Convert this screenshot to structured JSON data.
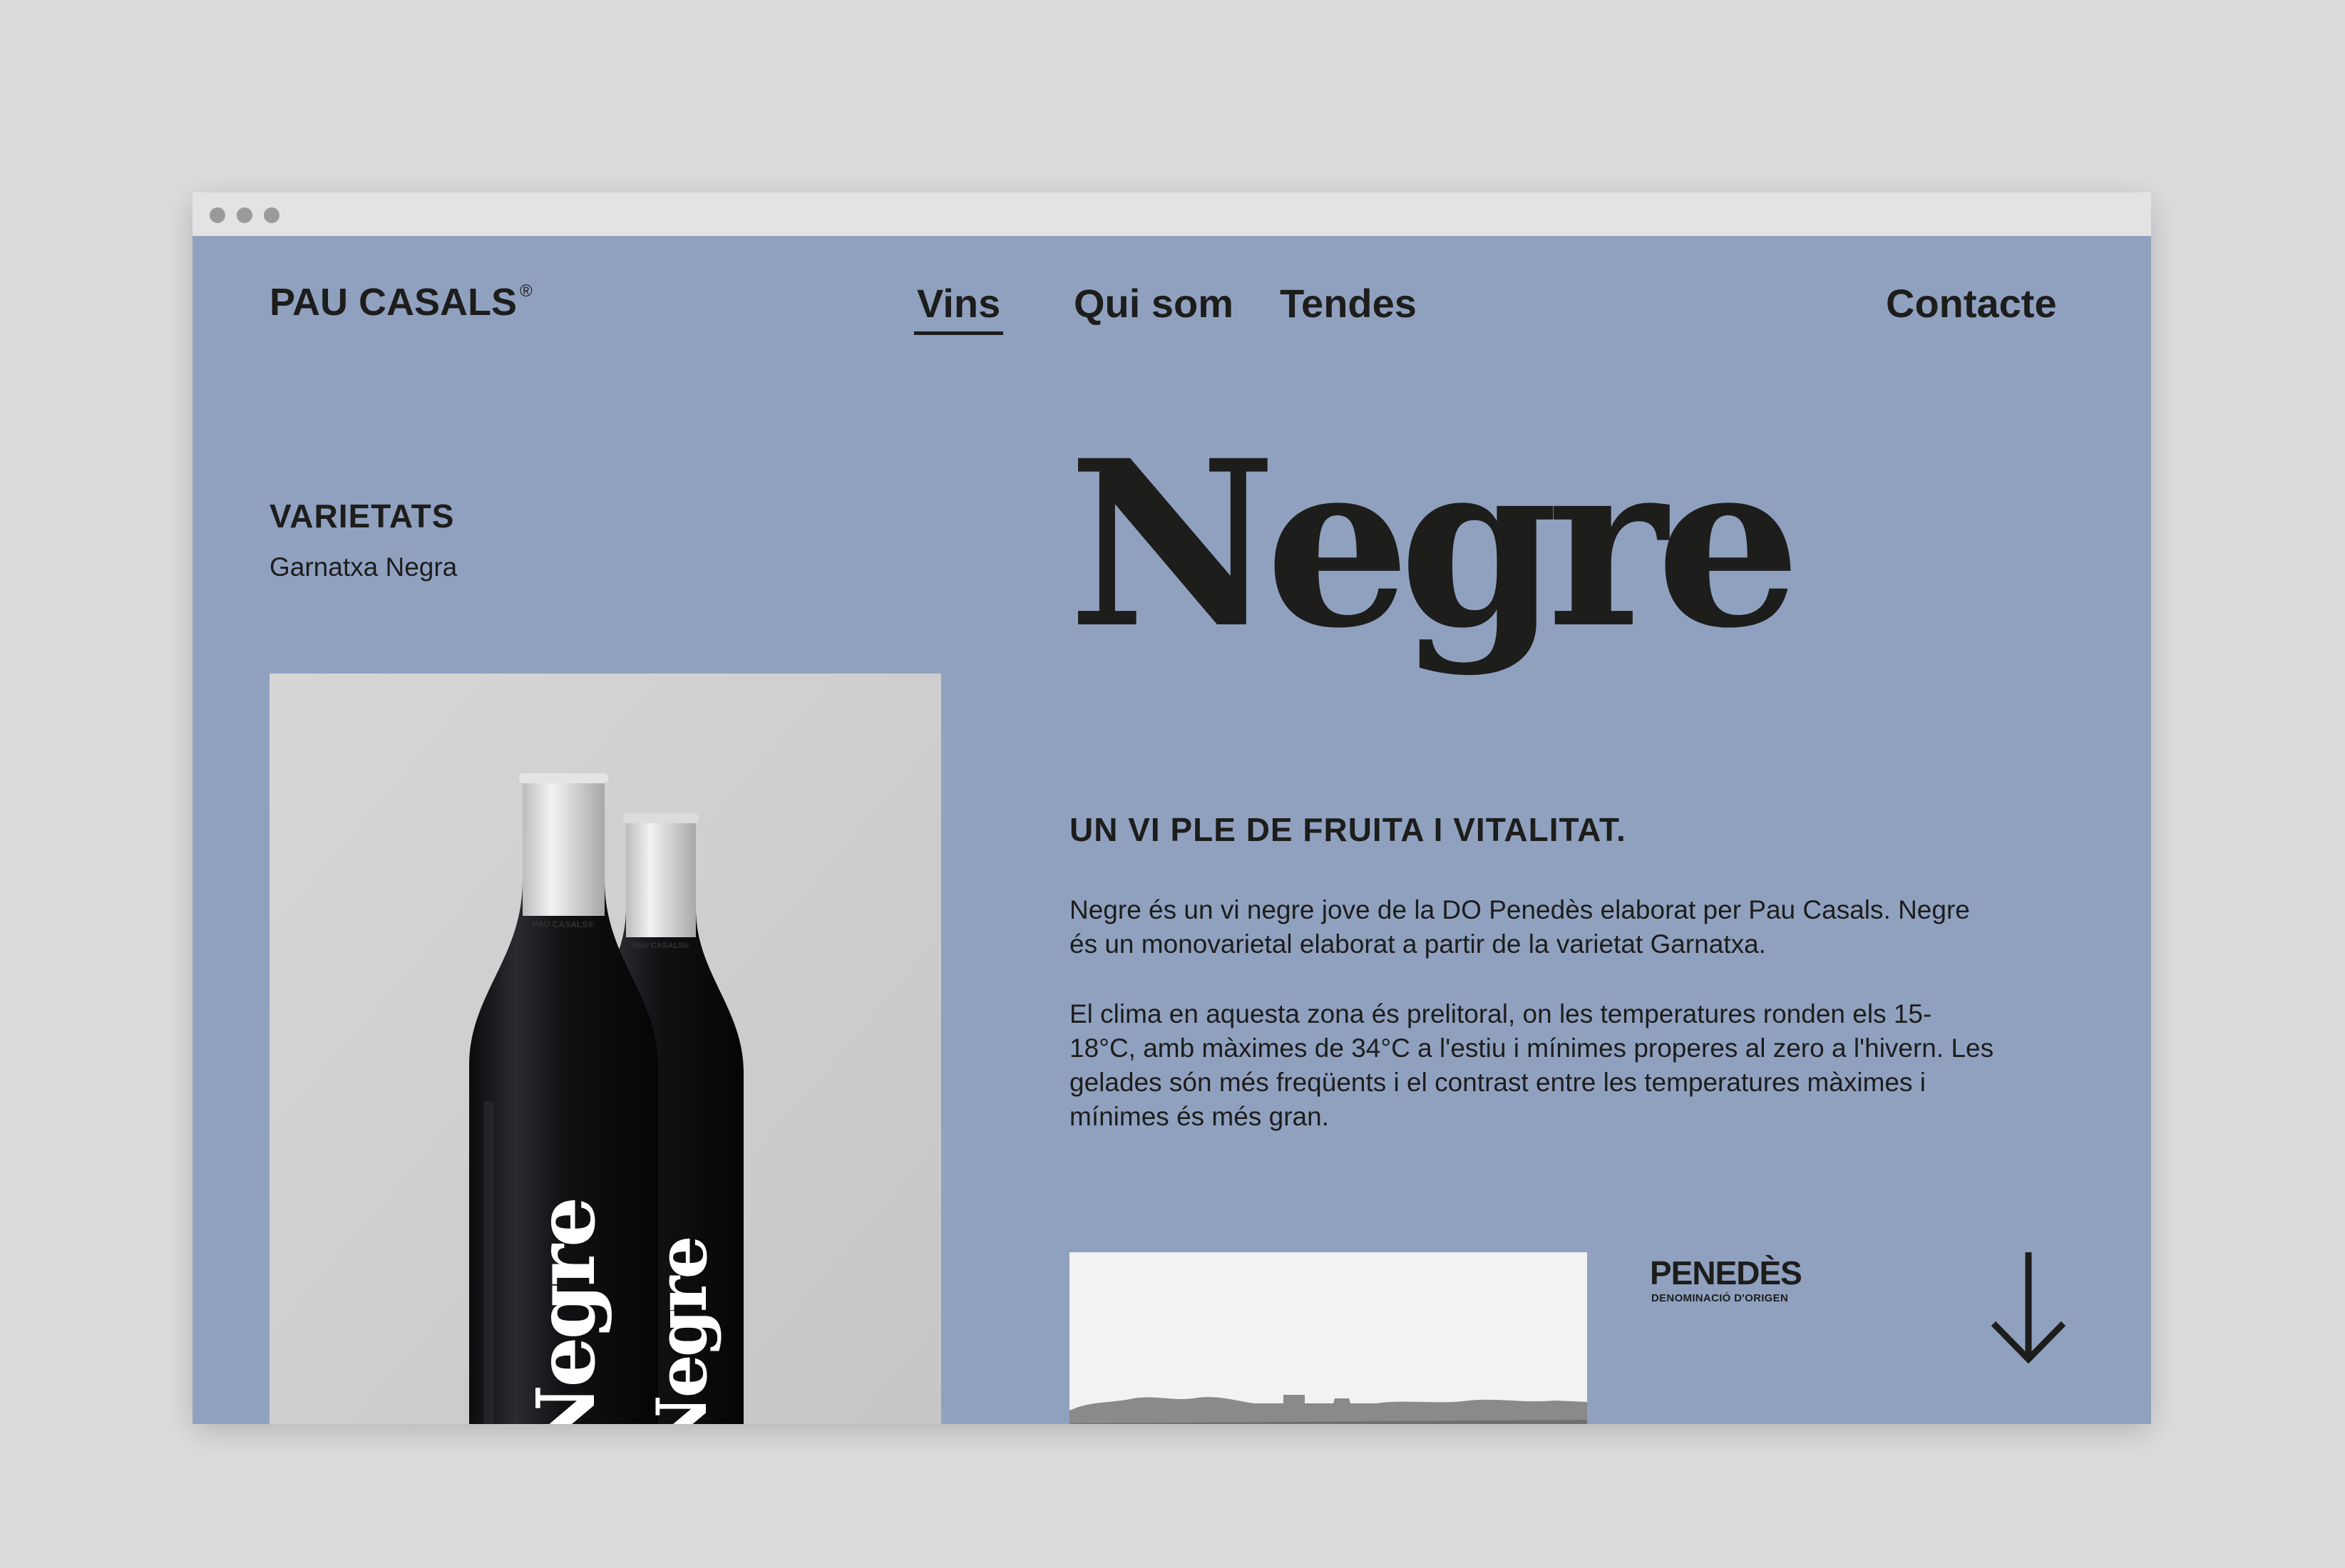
{
  "brand": {
    "name": "PAU CASALS",
    "mark": "®"
  },
  "nav": {
    "items": [
      {
        "label": "Vins",
        "active": true
      },
      {
        "label": "Qui som",
        "active": false
      },
      {
        "label": "Tendes",
        "active": false
      }
    ],
    "contact": "Contacte"
  },
  "sidebar": {
    "heading": "VARIETATS",
    "value": "Garnatxa Negra"
  },
  "product": {
    "title": "Negre",
    "tagline": "UN VI PLE DE FRUITA I VITALITAT.",
    "paragraphs": [
      "Negre és un vi negre jove de la DO Penedès elaborat per Pau Casals. Negre és un monovarietal elaborat a partir de la varietat Garnatxa.",
      "El clima en aquesta zona és prelitoral, on les temperatures ronden els 15-18°C, amb màximes de 34°C a l'estiu i mínimes properes al zero a l'hivern. Les gelades són més freqüents i el contrast entre les temperatures màximes i mínimes és més gran."
    ]
  },
  "bottle_label": {
    "wordmark": "Negre",
    "capsule_text": "PAU CASALS®"
  },
  "origin": {
    "name": "PENEDÈS",
    "sub": "DENOMINACIÓ D'ORIGEN"
  },
  "colors": {
    "page_bg": "#90a1c0",
    "text": "#1d1d1b",
    "chrome": "#e3e3e3"
  },
  "icons": {
    "scroll": "arrow-down-icon"
  }
}
